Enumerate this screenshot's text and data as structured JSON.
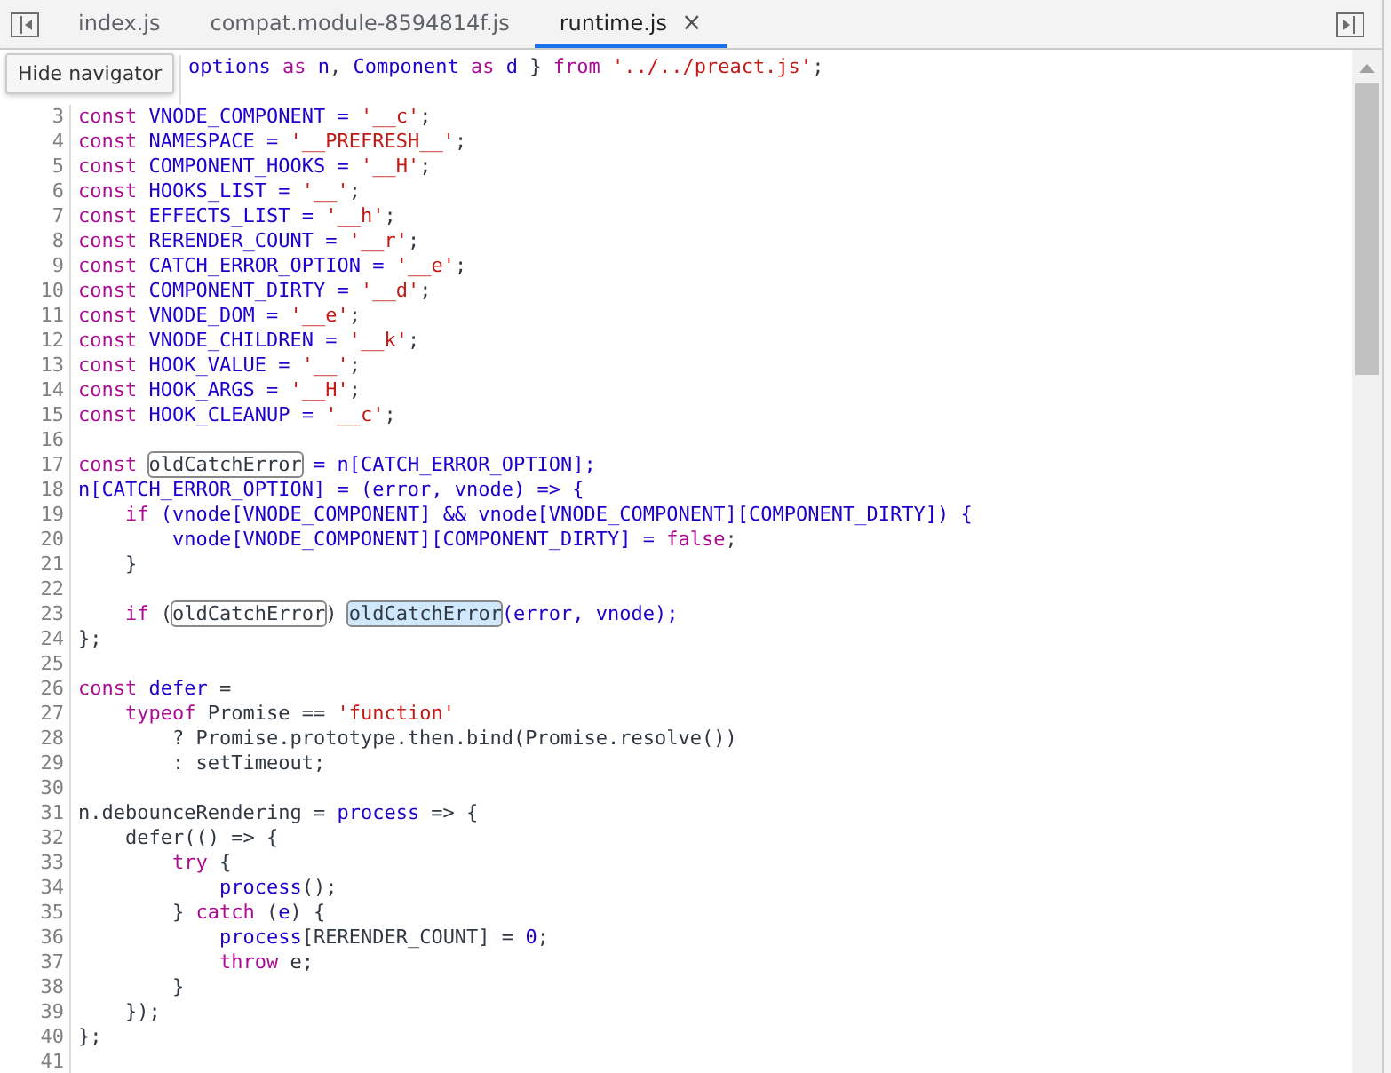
{
  "tabs": [
    {
      "label": "index.js",
      "selected": false,
      "closable": false
    },
    {
      "label": "compat.module-8594814f.js",
      "selected": false,
      "closable": false
    },
    {
      "label": "runtime.js",
      "selected": true,
      "closable": true,
      "close_glyph": "×"
    }
  ],
  "tooltip": {
    "text": "Hide navigator"
  },
  "code": [
    {
      "tokens": [
        {
          "kind": "name",
          "text": "options"
        },
        {
          "kind": "keyword",
          "text": " as "
        },
        {
          "kind": "name",
          "text": "n"
        },
        {
          "kind": "plain",
          "text": ", "
        },
        {
          "kind": "name",
          "text": "Component"
        },
        {
          "kind": "keyword",
          "text": " as "
        },
        {
          "kind": "name",
          "text": "d"
        },
        {
          "kind": "plain",
          "text": " } "
        },
        {
          "kind": "keyword",
          "text": "from "
        },
        {
          "kind": "string",
          "text": "'../../preact.js'"
        },
        {
          "kind": "plain",
          "text": ";"
        }
      ]
    },
    {
      "number": "3",
      "tokens": [
        {
          "kind": "keyword",
          "text": "const"
        },
        {
          "kind": "name",
          "text": " VNODE_COMPONENT = "
        },
        {
          "kind": "string",
          "text": "'__c'"
        },
        {
          "kind": "plain",
          "text": ";"
        }
      ]
    },
    {
      "number": "4",
      "tokens": [
        {
          "kind": "keyword",
          "text": "const"
        },
        {
          "kind": "name",
          "text": " NAMESPACE = "
        },
        {
          "kind": "string",
          "text": "'__PREFRESH__'"
        },
        {
          "kind": "plain",
          "text": ";"
        }
      ]
    },
    {
      "number": "5",
      "tokens": [
        {
          "kind": "keyword",
          "text": "const"
        },
        {
          "kind": "name",
          "text": " COMPONENT_HOOKS = "
        },
        {
          "kind": "string",
          "text": "'__H'"
        },
        {
          "kind": "plain",
          "text": ";"
        }
      ]
    },
    {
      "number": "6",
      "tokens": [
        {
          "kind": "keyword",
          "text": "const"
        },
        {
          "kind": "name",
          "text": " HOOKS_LIST = "
        },
        {
          "kind": "string",
          "text": "'__'"
        },
        {
          "kind": "plain",
          "text": ";"
        }
      ]
    },
    {
      "number": "7",
      "tokens": [
        {
          "kind": "keyword",
          "text": "const"
        },
        {
          "kind": "name",
          "text": " EFFECTS_LIST = "
        },
        {
          "kind": "string",
          "text": "'__h'"
        },
        {
          "kind": "plain",
          "text": ";"
        }
      ]
    },
    {
      "number": "8",
      "tokens": [
        {
          "kind": "keyword",
          "text": "const"
        },
        {
          "kind": "name",
          "text": " RERENDER_COUNT = "
        },
        {
          "kind": "string",
          "text": "'__r'"
        },
        {
          "kind": "plain",
          "text": ";"
        }
      ]
    },
    {
      "number": "9",
      "tokens": [
        {
          "kind": "keyword",
          "text": "const"
        },
        {
          "kind": "name",
          "text": " CATCH_ERROR_OPTION = "
        },
        {
          "kind": "string",
          "text": "'__e'"
        },
        {
          "kind": "plain",
          "text": ";"
        }
      ]
    },
    {
      "number": "10",
      "tokens": [
        {
          "kind": "keyword",
          "text": "const"
        },
        {
          "kind": "name",
          "text": " COMPONENT_DIRTY = "
        },
        {
          "kind": "string",
          "text": "'__d'"
        },
        {
          "kind": "plain",
          "text": ";"
        }
      ]
    },
    {
      "number": "11",
      "tokens": [
        {
          "kind": "keyword",
          "text": "const"
        },
        {
          "kind": "name",
          "text": " VNODE_DOM = "
        },
        {
          "kind": "string",
          "text": "'__e'"
        },
        {
          "kind": "plain",
          "text": ";"
        }
      ]
    },
    {
      "number": "12",
      "tokens": [
        {
          "kind": "keyword",
          "text": "const"
        },
        {
          "kind": "name",
          "text": " VNODE_CHILDREN = "
        },
        {
          "kind": "string",
          "text": "'__k'"
        },
        {
          "kind": "plain",
          "text": ";"
        }
      ]
    },
    {
      "number": "13",
      "tokens": [
        {
          "kind": "keyword",
          "text": "const"
        },
        {
          "kind": "name",
          "text": " HOOK_VALUE = "
        },
        {
          "kind": "string",
          "text": "'__'"
        },
        {
          "kind": "plain",
          "text": ";"
        }
      ]
    },
    {
      "number": "14",
      "tokens": [
        {
          "kind": "keyword",
          "text": "const"
        },
        {
          "kind": "name",
          "text": " HOOK_ARGS = "
        },
        {
          "kind": "string",
          "text": "'__H'"
        },
        {
          "kind": "plain",
          "text": ";"
        }
      ]
    },
    {
      "number": "15",
      "tokens": [
        {
          "kind": "keyword",
          "text": "const"
        },
        {
          "kind": "name",
          "text": " HOOK_CLEANUP = "
        },
        {
          "kind": "string",
          "text": "'__c'"
        },
        {
          "kind": "plain",
          "text": ";"
        }
      ]
    },
    {
      "number": "16"
    },
    {
      "number": "17",
      "tokens": [
        {
          "kind": "keyword",
          "text": "const "
        },
        {
          "kind": "plain",
          "text": "oldCatchError",
          "boxed": true,
          "selected": false
        },
        {
          "kind": "name",
          "text": " = n[CATCH_ERROR_OPTION];"
        }
      ]
    },
    {
      "number": "18",
      "tokens": [
        {
          "kind": "name",
          "text": "n[CATCH_ERROR_OPTION] = (error, vnode) => {"
        }
      ]
    },
    {
      "number": "19",
      "tokens": [
        {
          "kind": "keyword",
          "text": "    if"
        },
        {
          "kind": "name",
          "text": " (vnode[VNODE_COMPONENT] && vnode[VNODE_COMPONENT][COMPONENT_DIRTY]) {"
        }
      ]
    },
    {
      "number": "20",
      "tokens": [
        {
          "kind": "name",
          "text": "        vnode[VNODE_COMPONENT][COMPONENT_DIRTY] = "
        },
        {
          "kind": "keyword",
          "text": "false"
        },
        {
          "kind": "plain",
          "text": ";"
        }
      ]
    },
    {
      "number": "21",
      "tokens": [
        {
          "kind": "plain",
          "text": "    }"
        }
      ]
    },
    {
      "number": "22"
    },
    {
      "number": "23",
      "tokens": [
        {
          "kind": "keyword",
          "text": "    if"
        },
        {
          "kind": "plain",
          "text": " ("
        },
        {
          "kind": "plain",
          "text": "oldCatchError",
          "boxed": true,
          "selected": false
        },
        {
          "kind": "plain",
          "text": ") "
        },
        {
          "kind": "plain",
          "text": "oldCatchError",
          "boxed": true,
          "selected": true
        },
        {
          "kind": "name",
          "text": "(error, vnode);"
        }
      ]
    },
    {
      "number": "24",
      "tokens": [
        {
          "kind": "plain",
          "text": "};"
        }
      ]
    },
    {
      "number": "25"
    },
    {
      "number": "26",
      "tokens": [
        {
          "kind": "keyword",
          "text": "const "
        },
        {
          "kind": "name",
          "text": "defer"
        },
        {
          "kind": "plain",
          "text": " ="
        }
      ]
    },
    {
      "number": "27",
      "tokens": [
        {
          "kind": "keyword",
          "text": "    typeof"
        },
        {
          "kind": "plain",
          "text": " Promise == "
        },
        {
          "kind": "string",
          "text": "'function'"
        }
      ]
    },
    {
      "number": "28",
      "tokens": [
        {
          "kind": "plain",
          "text": "        ? Promise.prototype.then.bind(Promise.resolve())"
        }
      ]
    },
    {
      "number": "29",
      "tokens": [
        {
          "kind": "plain",
          "text": "        : setTimeout;"
        }
      ]
    },
    {
      "number": "30"
    },
    {
      "number": "31",
      "tokens": [
        {
          "kind": "plain",
          "text": "n.debounceRendering = "
        },
        {
          "kind": "name",
          "text": "process"
        },
        {
          "kind": "plain",
          "text": " => {"
        }
      ]
    },
    {
      "number": "32",
      "tokens": [
        {
          "kind": "plain",
          "text": "    defer(() => {"
        }
      ]
    },
    {
      "number": "33",
      "tokens": [
        {
          "kind": "keyword",
          "text": "        try"
        },
        {
          "kind": "plain",
          "text": " {"
        }
      ]
    },
    {
      "number": "34",
      "tokens": [
        {
          "kind": "name",
          "text": "            process"
        },
        {
          "kind": "plain",
          "text": "();"
        }
      ]
    },
    {
      "number": "35",
      "tokens": [
        {
          "kind": "plain",
          "text": "        } "
        },
        {
          "kind": "keyword",
          "text": "catch"
        },
        {
          "kind": "plain",
          "text": " ("
        },
        {
          "kind": "name",
          "text": "e"
        },
        {
          "kind": "plain",
          "text": ") {"
        }
      ]
    },
    {
      "number": "36",
      "tokens": [
        {
          "kind": "name",
          "text": "            process"
        },
        {
          "kind": "plain",
          "text": "[RERENDER_COUNT] = "
        },
        {
          "kind": "number",
          "text": "0"
        },
        {
          "kind": "plain",
          "text": ";"
        }
      ]
    },
    {
      "number": "37",
      "tokens": [
        {
          "kind": "keyword",
          "text": "            throw"
        },
        {
          "kind": "plain",
          "text": " e;"
        }
      ]
    },
    {
      "number": "38",
      "tokens": [
        {
          "kind": "plain",
          "text": "        }"
        }
      ]
    },
    {
      "number": "39",
      "tokens": [
        {
          "kind": "plain",
          "text": "    });"
        }
      ]
    },
    {
      "number": "40",
      "tokens": [
        {
          "kind": "plain",
          "text": "};"
        }
      ]
    },
    {
      "number": "41"
    }
  ]
}
